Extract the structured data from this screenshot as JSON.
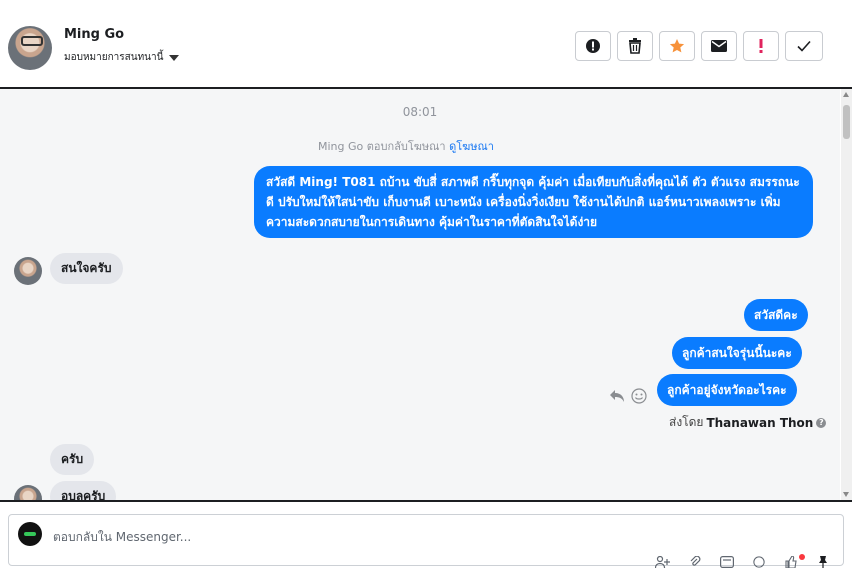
{
  "header": {
    "contact_name": "Ming Go",
    "assign_label": "มอบหมายการสนทนานี้",
    "actions": [
      "spam-icon",
      "trash-icon",
      "star-icon",
      "mail-icon",
      "important-icon",
      "check-icon"
    ]
  },
  "chat": {
    "timestamp": "08:01",
    "reply_notice": "Ming Go ตอบกลับโฆษณา",
    "view_ad_link": "ดูโฆษณา",
    "messages": [
      {
        "from": "page",
        "text": "สวัสดี Ming!  T081 ถบ้าน ขับสี่ สภาพดี กริ๊บทุกจุด คุ้มค่า เมื่อเทียบกับสิ่งที่คุณได้ ตัว ตัวแรง สมรรถนะดี ปรับใหม่ให้ใสน่าขับ เก็บงานดี เบาะหนัง เครื่องนิ่งวิ่งเงียบ ใช้งานได้ปกติ แอร์หนาวเพลงเพราะ  เพิ่มความสะดวกสบายในการเดินทาง คุ้มค่าในราคาที่ตัดสินใจได้ง่าย"
      },
      {
        "from": "contact",
        "text": "สนใจครับ"
      },
      {
        "from": "page",
        "text": "สวัสดีคะ"
      },
      {
        "from": "page",
        "text": "ลูกค้าสนใจรุ่นนี้นะคะ"
      },
      {
        "from": "page",
        "text": "ลูกค้าอยู่จังหวัดอะไรคะ"
      },
      {
        "from": "contact",
        "text": "ครับ"
      },
      {
        "from": "contact",
        "text": "อบลครับ"
      }
    ],
    "sent_by_prefix": "ส่งโดย",
    "sent_by_name": "Thanawan Thon",
    "info_glyph": "?"
  },
  "composer": {
    "placeholder": "ตอบกลับใน Messenger..."
  },
  "colors": {
    "blue_bubble": "#0a7cff",
    "grey_bubble": "#e4e6eb",
    "star": "#f7923b",
    "important": "#e0245e"
  }
}
